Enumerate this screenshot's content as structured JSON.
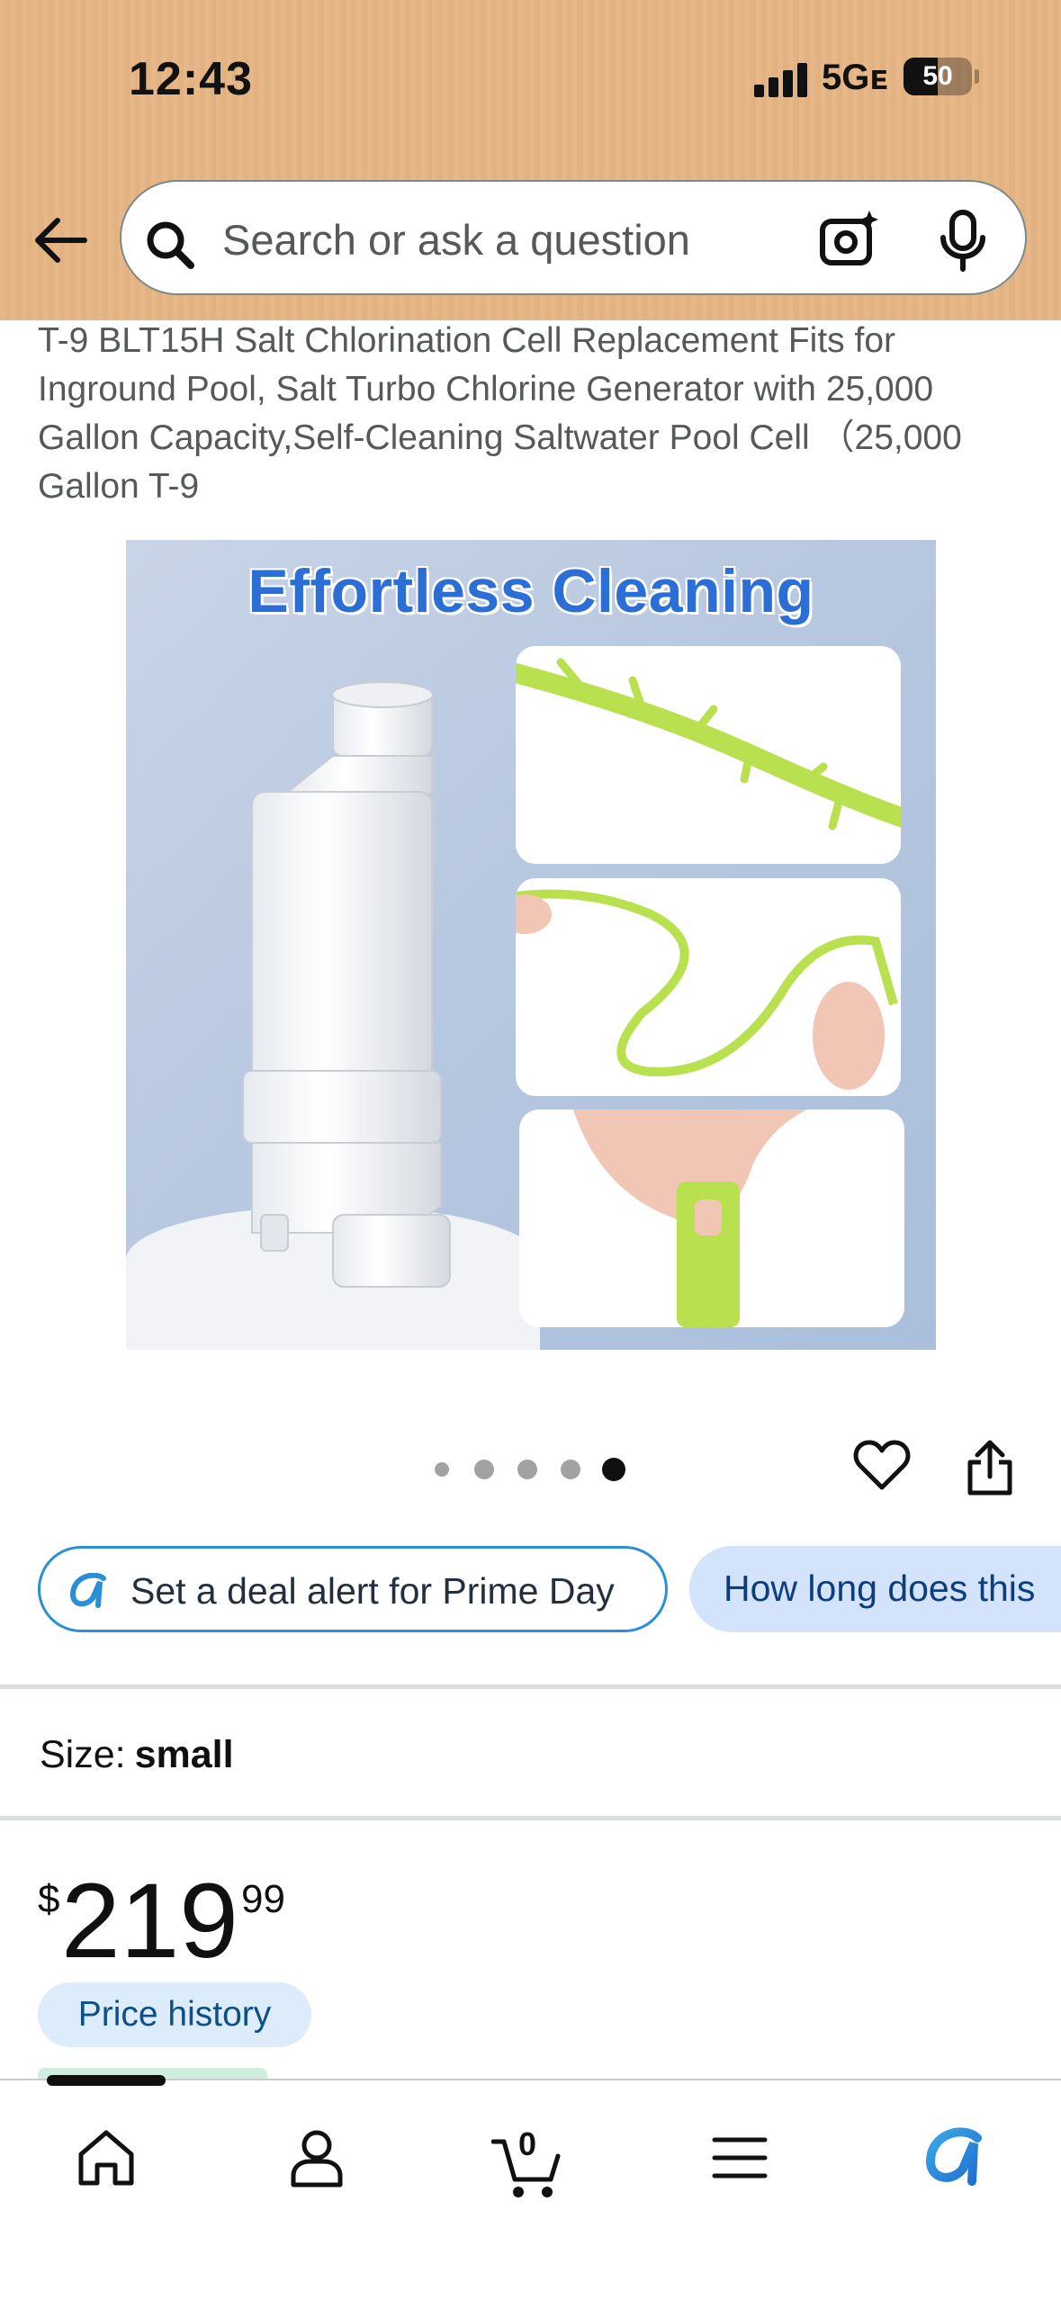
{
  "status_bar": {
    "time": "12:43",
    "network": "5Gᴇ",
    "battery": "50"
  },
  "search": {
    "placeholder": "Search or ask a question"
  },
  "product": {
    "title": "T-9 BLT15H Salt Chlorination Cell Replacement Fits for Inground Pool, Salt Turbo Chlorine Generator with 25,000 Gallon Capacity,Self-Cleaning Saltwater Pool Cell （25,000 Gallon T-9",
    "image_headline": "Effortless Cleaning",
    "carousel": {
      "total": 5,
      "active": 5
    }
  },
  "chips": {
    "deal_alert": "Set a deal alert for Prime Day",
    "question": "How long does this"
  },
  "size": {
    "label": "Size:",
    "value": "small"
  },
  "price": {
    "symbol": "$",
    "whole": "219",
    "fraction": "99",
    "history_label": "Price history"
  },
  "tabbar": {
    "cart_count": "0",
    "items": [
      "home-icon",
      "account-icon",
      "cart-icon",
      "menu-icon",
      "rufus-icon"
    ]
  },
  "colors": {
    "header": "#e7b887",
    "accent_blue": "#2a8fd6",
    "chip_bg": "#d2e3fb"
  }
}
